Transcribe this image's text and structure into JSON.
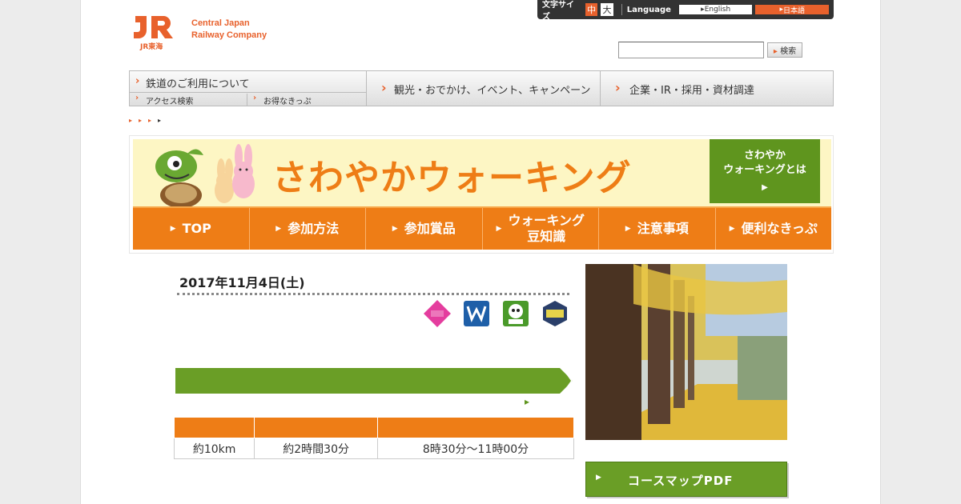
{
  "header": {
    "logo_mark": "JR",
    "logo_sub": "JR東海",
    "company_line1": "Central Japan",
    "company_line2": "Railway Company"
  },
  "util": {
    "font_size_label": "文字サイズ",
    "size_mid": "中",
    "size_big": "大",
    "language_label": "Language",
    "lang_en": "English",
    "lang_jp": "日本語"
  },
  "search": {
    "label": "",
    "button": "検索",
    "value": ""
  },
  "gnav": {
    "item1": "鉄道のご利用について",
    "item1_sub1": "アクセス検索",
    "item1_sub2": "お得なきっぷ",
    "item2": "観光・おでかけ、イベント、キャンペーン",
    "item3": "企業・IR・採用・資材調達"
  },
  "banner": {
    "title": "さわやかウォーキング",
    "whatis_line1": "さわやか",
    "whatis_line2": "ウォーキングとは",
    "nav": [
      "TOP",
      "参加方法",
      "参加賞品",
      "ウォーキング\n豆知識",
      "注意事項",
      "便利なきっぷ"
    ]
  },
  "event": {
    "date": "2017年11月4日(土)",
    "course_title": "",
    "route": "",
    "detail_link": "",
    "table_headers": [
      "",
      "",
      ""
    ],
    "table_values": [
      "約10km",
      "約2時間30分",
      "8時30分～11時00分"
    ],
    "photo_caption": "",
    "pdf_button": "コースマップPDF"
  },
  "colors": {
    "orange": "#ee7d16",
    "green": "#5f951e",
    "yellow": "#fdf6c4"
  }
}
